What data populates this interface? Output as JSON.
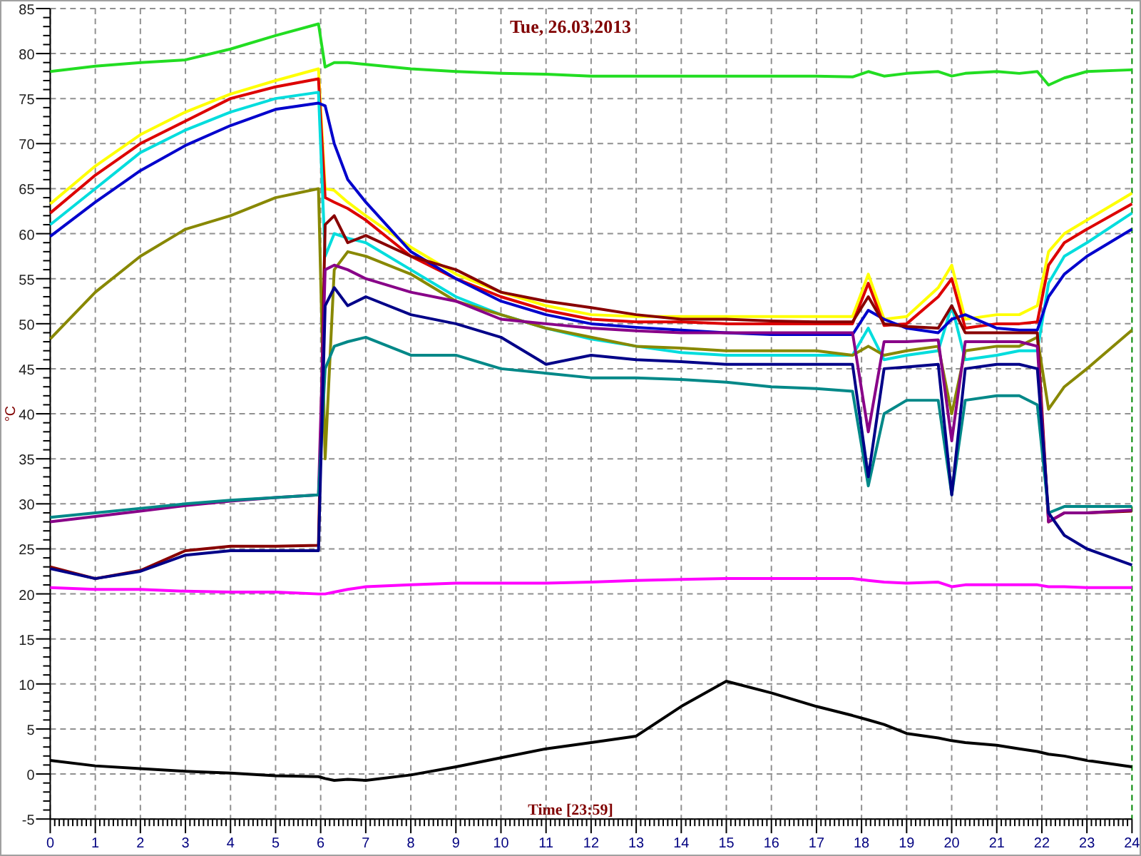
{
  "chart_data": {
    "type": "line",
    "title": "Tue, 26.03.2013",
    "xlabel": "Time [23:59]",
    "ylabel": "°C",
    "grid": true,
    "xlim": [
      0,
      24
    ],
    "ylim": [
      -5,
      85
    ],
    "xticks": [
      0,
      1,
      2,
      3,
      4,
      5,
      6,
      7,
      8,
      9,
      10,
      11,
      12,
      13,
      14,
      15,
      16,
      17,
      18,
      19,
      20,
      21,
      22,
      23,
      24
    ],
    "yticks": [
      -5,
      0,
      5,
      10,
      15,
      20,
      25,
      30,
      35,
      40,
      45,
      50,
      55,
      60,
      65,
      70,
      75,
      80,
      85
    ],
    "x": [
      0,
      1,
      2,
      3,
      4,
      5,
      5.95,
      6.1,
      6.3,
      6.6,
      7,
      8,
      9,
      10,
      11,
      12,
      13,
      14,
      15,
      16,
      17,
      17.8,
      18.15,
      18.5,
      19,
      19.7,
      20,
      20.3,
      21,
      21.5,
      21.9,
      22.15,
      22.5,
      23,
      24
    ],
    "series": [
      {
        "color": "#22dd22",
        "values": [
          78,
          78.6,
          79,
          79.3,
          80.5,
          82,
          83.3,
          78.5,
          79,
          79,
          78.8,
          78.3,
          78,
          77.8,
          77.7,
          77.5,
          77.5,
          77.5,
          77.5,
          77.5,
          77.5,
          77.4,
          78,
          77.5,
          77.8,
          78,
          77.5,
          77.8,
          78,
          77.8,
          78,
          76.5,
          77.3,
          78,
          78.2
        ]
      },
      {
        "color": "#ffff00",
        "values": [
          63.3,
          67.5,
          71,
          73.5,
          75.5,
          77,
          78.3,
          65,
          64.8,
          63.5,
          62,
          58.5,
          55.5,
          53.5,
          52,
          51,
          50.8,
          50.8,
          50.8,
          50.8,
          50.8,
          50.8,
          55.5,
          50.5,
          50.8,
          54,
          56.5,
          50.5,
          51,
          51,
          52,
          58,
          60,
          61.5,
          64.5
        ]
      },
      {
        "color": "#dd0000",
        "values": [
          62.3,
          66.5,
          70,
          72.5,
          75,
          76.3,
          77.2,
          64,
          63.5,
          62.8,
          61.5,
          57.5,
          55,
          53,
          51.5,
          50.5,
          50.2,
          50.2,
          50,
          50,
          50,
          50,
          54.5,
          49.8,
          50,
          53,
          55,
          49.5,
          50,
          50,
          50.2,
          56.5,
          59,
          60.5,
          63.3
        ]
      },
      {
        "color": "#00dddd",
        "values": [
          61,
          65,
          69,
          71.5,
          73.5,
          75,
          75.7,
          57.5,
          60,
          59.5,
          59,
          56,
          53,
          51,
          49.5,
          48.3,
          47.5,
          46.8,
          46.5,
          46.5,
          46.5,
          46.5,
          49.5,
          46,
          46.5,
          47,
          52,
          46,
          46.5,
          47,
          47,
          54.5,
          57.5,
          59,
          62.3
        ]
      },
      {
        "color": "#0000cc",
        "values": [
          59.7,
          63.5,
          67,
          69.8,
          72,
          73.8,
          74.5,
          74.2,
          70,
          66,
          63.5,
          58,
          55,
          52.5,
          51,
          50,
          49.6,
          49.3,
          49,
          48.8,
          48.8,
          48.8,
          51.5,
          50.5,
          49.5,
          49,
          50.5,
          51,
          49.5,
          49.3,
          49.3,
          53,
          55.5,
          57.5,
          60.5
        ]
      },
      {
        "color": "#888800",
        "values": [
          48.3,
          53.5,
          57.5,
          60.5,
          62,
          64,
          65,
          35,
          56,
          58,
          57.5,
          55.5,
          52.5,
          51,
          49.5,
          48.5,
          47.5,
          47.3,
          47,
          47,
          47,
          46.5,
          47.5,
          46.5,
          47,
          47.5,
          40,
          47,
          47.5,
          47.5,
          48.5,
          40.5,
          43,
          45,
          49.3
        ]
      },
      {
        "color": "#880000",
        "values": [
          23,
          21.7,
          22.6,
          24.8,
          25.3,
          25.3,
          25.4,
          61,
          62,
          59,
          59.8,
          57.5,
          56,
          53.5,
          52.5,
          51.8,
          51,
          50.5,
          50.5,
          50.3,
          50.2,
          50.2,
          53,
          50,
          49.7,
          49.5,
          52,
          49,
          49,
          49,
          49,
          28,
          29,
          29,
          29.2
        ]
      },
      {
        "color": "#880088",
        "values": [
          28,
          28.6,
          29.2,
          29.8,
          30.3,
          30.7,
          31,
          56,
          56.5,
          56,
          55,
          53.5,
          52.5,
          50.5,
          50,
          49.5,
          49.2,
          49,
          49,
          49,
          49,
          49,
          38,
          48,
          48,
          48.2,
          37,
          48,
          48,
          48,
          47.5,
          28,
          29,
          29,
          29.3
        ]
      },
      {
        "color": "#008888",
        "values": [
          28.5,
          29,
          29.5,
          30,
          30.4,
          30.7,
          31,
          45,
          47.5,
          48,
          48.5,
          46.5,
          46.5,
          45,
          44.5,
          44,
          44,
          43.8,
          43.5,
          43,
          42.8,
          42.5,
          32,
          40,
          41.5,
          41.5,
          31,
          41.5,
          42,
          42,
          41,
          29,
          29.7,
          29.7,
          29.7
        ]
      },
      {
        "color": "#000088",
        "values": [
          22.8,
          21.7,
          22.5,
          24.3,
          24.8,
          24.8,
          24.8,
          52,
          54,
          52,
          53,
          51,
          50,
          48.5,
          45.5,
          46.5,
          46,
          45.8,
          45.5,
          45.5,
          45.5,
          45.5,
          33,
          45,
          45.2,
          45.5,
          31,
          45,
          45.5,
          45.5,
          45,
          29,
          26.5,
          25,
          23.2
        ]
      },
      {
        "color": "#ff00ff",
        "values": [
          20.7,
          20.5,
          20.5,
          20.3,
          20.2,
          20.2,
          20,
          20,
          20.2,
          20.5,
          20.8,
          21,
          21.2,
          21.2,
          21.2,
          21.3,
          21.5,
          21.6,
          21.7,
          21.7,
          21.7,
          21.7,
          21.5,
          21.3,
          21.2,
          21.3,
          20.8,
          21,
          21,
          21,
          21,
          20.8,
          20.8,
          20.7,
          20.7
        ]
      },
      {
        "color": "#000000",
        "values": [
          1.5,
          0.9,
          0.6,
          0.3,
          0.1,
          -0.2,
          -0.3,
          -0.5,
          -0.7,
          -0.6,
          -0.7,
          -0.1,
          0.8,
          1.8,
          2.8,
          3.5,
          4.2,
          7.5,
          10.3,
          9,
          7.5,
          6.5,
          6,
          5.5,
          4.5,
          4,
          3.7,
          3.5,
          3.2,
          2.8,
          2.5,
          2.2,
          2,
          1.5,
          0.8
        ]
      }
    ]
  }
}
